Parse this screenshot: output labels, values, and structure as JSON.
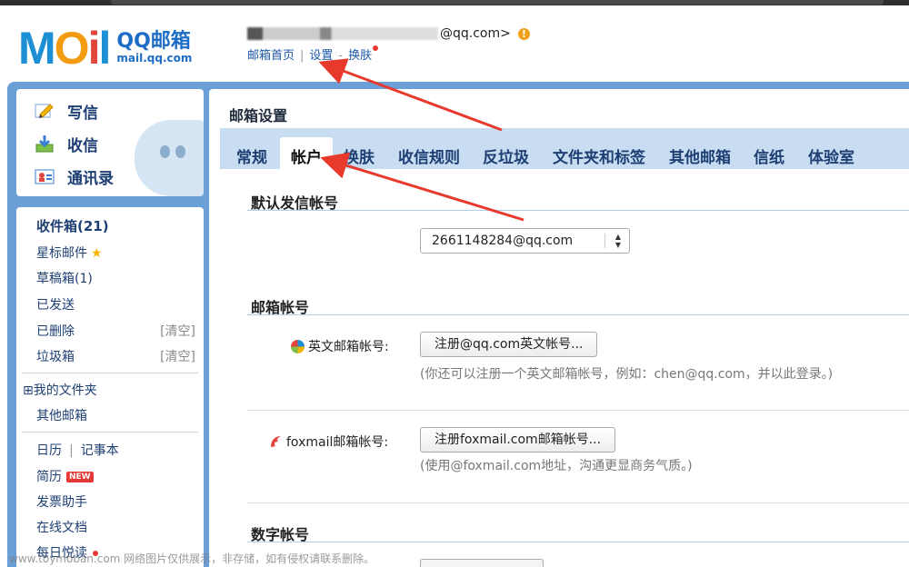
{
  "header": {
    "logo_cn": "QQ邮箱",
    "logo_en": "mail.qq.com",
    "email_suffix": "@qq.com>",
    "warn_glyph": "!",
    "links": [
      "邮箱首页",
      "设置",
      "换肤"
    ],
    "sep1": "|",
    "sep2": "-"
  },
  "sidebar": {
    "actions": [
      {
        "label": "写信",
        "icon": "pencil-icon"
      },
      {
        "label": "收信",
        "icon": "download-icon"
      },
      {
        "label": "通讯录",
        "icon": "contacts-icon"
      }
    ],
    "folders": {
      "inbox": "收件箱(21)",
      "starred": "星标邮件",
      "drafts": "草稿箱(1)",
      "sent": "已发送",
      "deleted": "已删除",
      "spam": "垃圾箱",
      "clear": "[清空]",
      "my_folders": "⊞我的文件夹",
      "other_mail": "其他邮箱",
      "calendar": "日历",
      "pipe": "|",
      "notes": "记事本",
      "resume": "简历",
      "new_badge": "NEW",
      "invoice": "发票助手",
      "docs": "在线文档",
      "daily": "每日悦读"
    }
  },
  "content": {
    "title": "邮箱设置",
    "tabs": [
      "常规",
      "帐户",
      "换肤",
      "收信规则",
      "反垃圾",
      "文件夹和标签",
      "其他邮箱",
      "信纸",
      "体验室"
    ],
    "active_tab": "帐户",
    "default_sender_heading": "默认发信帐号",
    "default_sender_value": "2661148284@qq.com",
    "mail_account_heading": "邮箱帐号",
    "english_label": "英文邮箱帐号:",
    "english_button": "注册@qq.com英文帐号...",
    "english_hint": "(你还可以注册一个英文邮箱帐号，例如：chen@qq.com，并以此登录。)",
    "foxmail_label": "foxmail邮箱帐号:",
    "foxmail_button": "注册foxmail.com邮箱帐号...",
    "foxmail_hint": "(使用@foxmail.com地址，沟通更显商务气质。)",
    "digital_heading": "数字帐号"
  },
  "watermark": "www.toymoban.com 网络图片仅供展示，非存储，如有侵权请联系删除。",
  "colors": {
    "frame_blue": "#6b9fd8",
    "tab_bar": "#c9ddf2",
    "link_blue": "#1d59a8",
    "arrow_red": "#e8392d"
  }
}
